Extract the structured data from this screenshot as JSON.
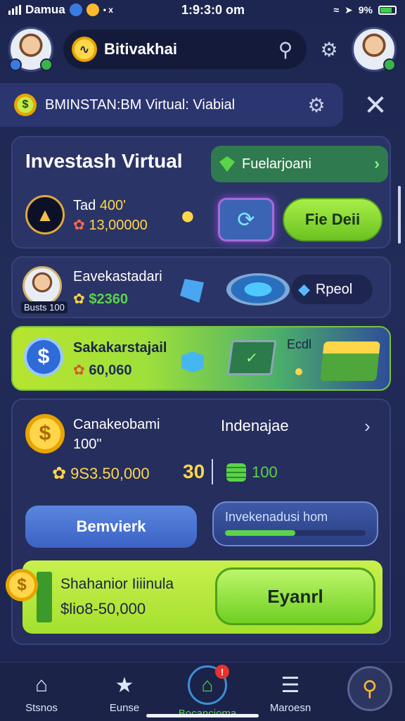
{
  "status_bar": {
    "carrier": "Damua",
    "extra": "• x",
    "time": "1:9:3:0 om",
    "battery": "9%"
  },
  "header": {
    "app_title": "Bitivakhai"
  },
  "banner": {
    "title": "BMINSTAN:BM Virtual: Viabial"
  },
  "card1": {
    "title": "Investash Virtual",
    "pill_label": "Fuelarjoani",
    "stat_label": "Tad",
    "stat_value": "400'",
    "stat_amount": "13,00000",
    "button_label": "Fie Deii"
  },
  "card2": {
    "avatar_tag": "Busts 100",
    "name": "Eavekastadari",
    "value": "$2360",
    "pill_label": "Rpeol"
  },
  "card3": {
    "name": "Sakakarstajail",
    "value": "60,060",
    "small_label": "Ecdl"
  },
  "card4": {
    "name": "Canakeobami",
    "sub": "100\"",
    "right_title": "Indenajae",
    "money": "9S3.50,000",
    "big_number": "30",
    "coins": "100",
    "blue_button": "Bemvierk",
    "progress_label": "Invekenadusi hom",
    "progress_fraction": 0.5,
    "lime_title": "Shahanior Iiiinula",
    "lime_amount": "$lio8-50,000",
    "lime_button": "Eyanrl"
  },
  "bottom_nav": {
    "items": [
      {
        "label": "Stsnos"
      },
      {
        "label": "Eunse"
      },
      {
        "label": "Bocancioma"
      },
      {
        "label": "Maroesn"
      }
    ],
    "notification_count": "!"
  },
  "colors": {
    "background": "#1d2650",
    "accent_green": "#6cc221",
    "accent_gold": "#ffd64a",
    "card": "#2a3466"
  },
  "icons": [
    "signal-bars-icon",
    "wifi-icon",
    "battery-icon",
    "settings-gear-icon",
    "close-icon",
    "chevron-right-icon",
    "home-icon",
    "star-icon",
    "home-lock-icon",
    "menu-icon",
    "search-icon"
  ]
}
